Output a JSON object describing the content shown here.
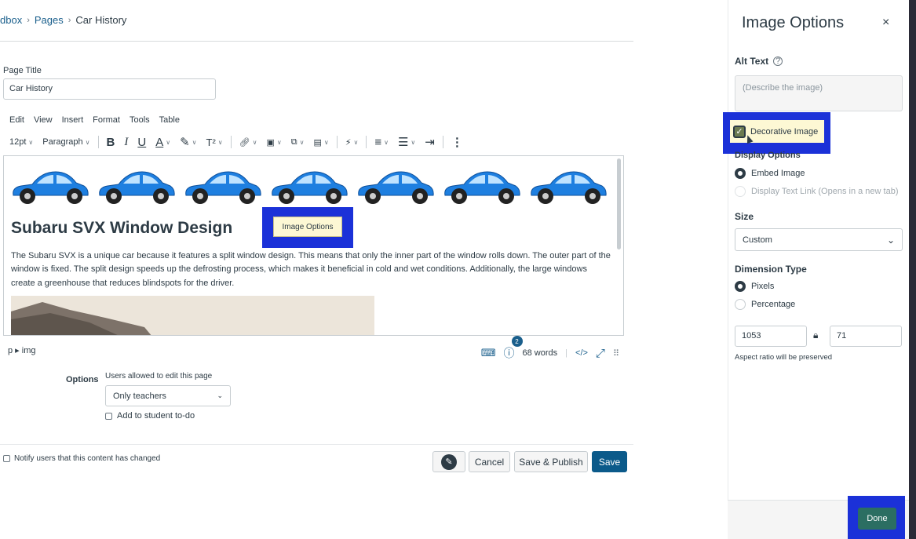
{
  "breadcrumb": {
    "items": [
      "dbox",
      "Pages",
      "Car History"
    ],
    "separator": "›"
  },
  "page_title": {
    "label": "Page Title",
    "value": "Car History"
  },
  "menubar": [
    "Edit",
    "View",
    "Insert",
    "Format",
    "Tools",
    "Table"
  ],
  "toolbar": {
    "font_size": "12pt",
    "block_format": "Paragraph",
    "bold": "B",
    "italic": "I",
    "underline": "U",
    "text_color": "A",
    "superscript": "T²",
    "more": "⋮"
  },
  "editor": {
    "car_count": 7,
    "heading": "Subaru SVX Window Design",
    "image_options_button": "Image Options",
    "paragraph": "The Subaru SVX is a unique car because it features a split window design. This means that only the inner part of the window rolls down. The outer part of the window is fixed. The split design speeds up the defrosting process, which makes it beneficial in cold and wet conditions. Additionally, the large windows create a greenhouse that reduces blindspots for the driver."
  },
  "statusbar": {
    "path": "p ▸ img",
    "a11y_badge": "2",
    "word_count": "68 words",
    "html_toggle": "</>"
  },
  "options": {
    "label": "Options",
    "edit_label": "Users allowed to edit this page",
    "edit_value": "Only teachers",
    "todo_label": "Add to student to-do"
  },
  "notify_label": "Notify users that this content has changed",
  "footer": {
    "cancel": "Cancel",
    "save_publish": "Save & Publish",
    "save": "Save"
  },
  "tray": {
    "title": "Image Options",
    "close": "×",
    "alt_text_label": "Alt Text",
    "alt_text_placeholder": "(Describe the image)",
    "decorative_label": "Decorative Image",
    "display_options_label": "Display Options",
    "embed_label": "Embed Image",
    "link_label": "Display Text Link (Opens in a new tab)",
    "size_label": "Size",
    "size_value": "Custom",
    "dimension_type_label": "Dimension Type",
    "pixels_label": "Pixels",
    "percentage_label": "Percentage",
    "width": "1053",
    "height": "71",
    "aspect_note": "Aspect ratio will be preserved",
    "done": "Done"
  },
  "colors": {
    "highlight": "#1b31d8",
    "primary": "#0b5a8a",
    "done": "#2b6e62",
    "link": "#1a5f8c",
    "car": "#1e7fe0"
  }
}
